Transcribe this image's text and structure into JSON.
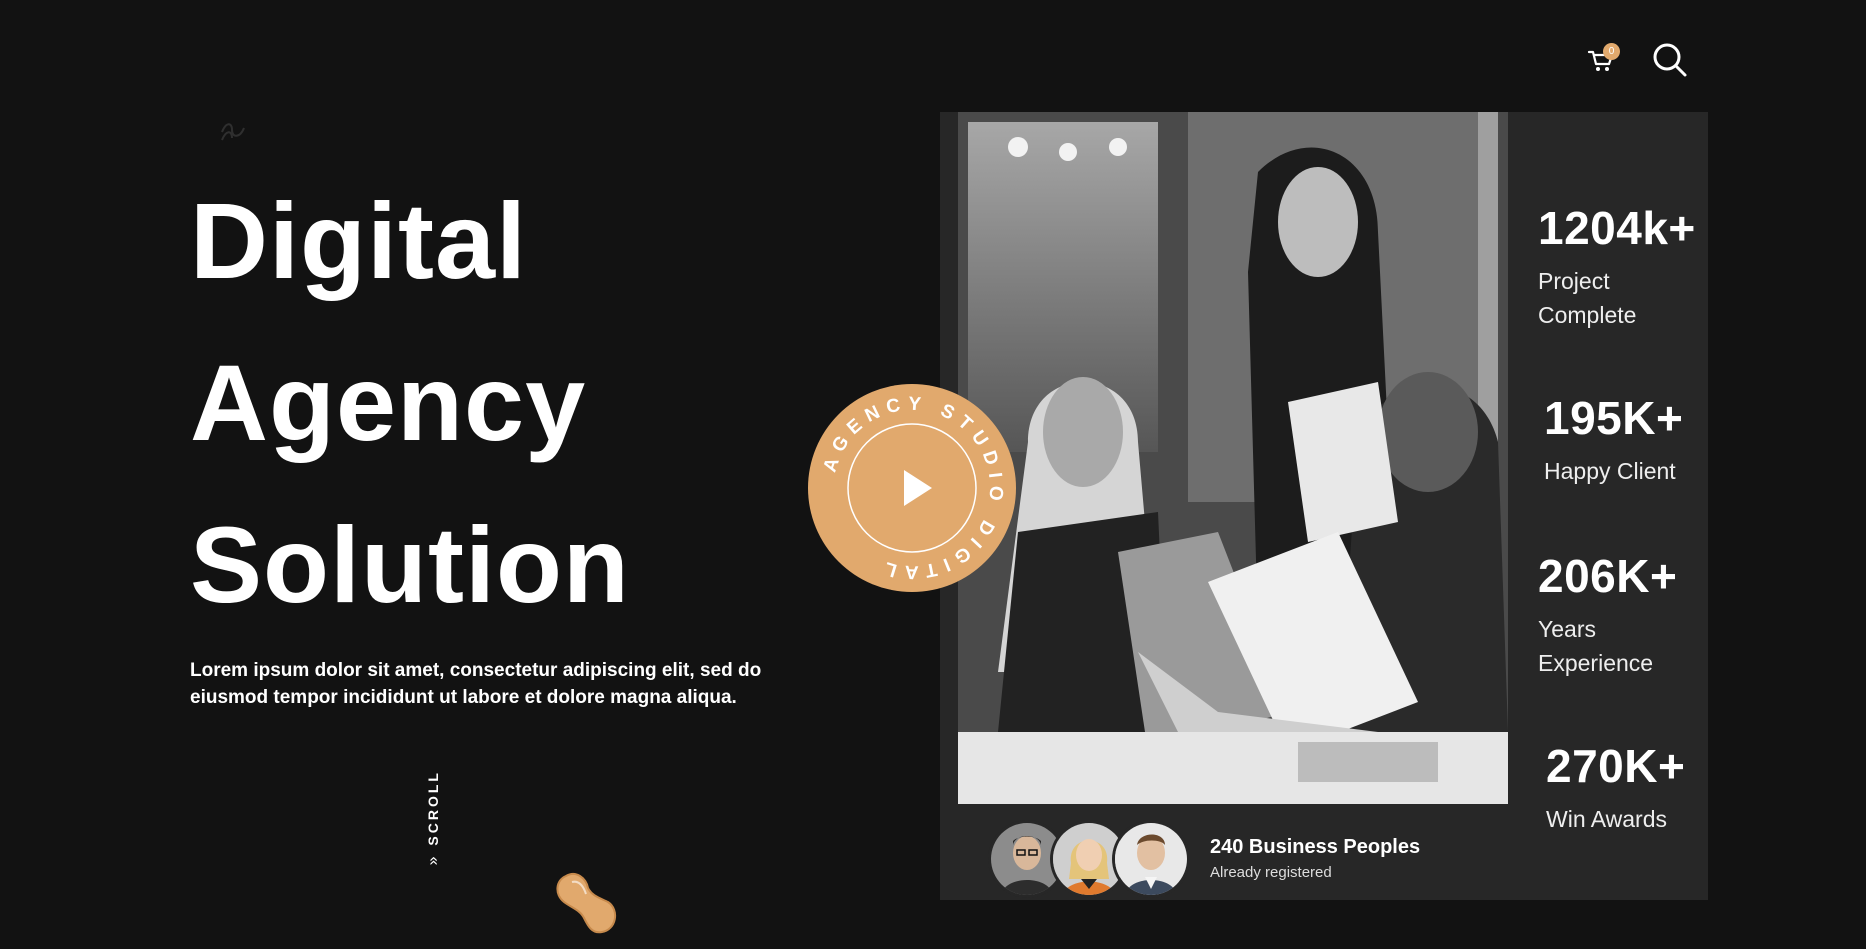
{
  "header": {
    "cart_count": "0",
    "icons": [
      "cart-icon",
      "search-icon"
    ]
  },
  "hero": {
    "title_lines": [
      "Digital",
      "Agency",
      "Solution"
    ],
    "description_line1": "Lorem ipsum dolor sit amet, consectetur adipiscing elit, sed do",
    "description_line2": "eiusmod tempor incididunt ut labore et dolore magna aliqua."
  },
  "scroll_label": "SCROLL",
  "badge": {
    "circular_text": "AGENCY STUDIO DIGITAL",
    "icon": "play-icon"
  },
  "stats": [
    {
      "value": "1204k+",
      "label_line1": "Project",
      "label_line2": "Complete"
    },
    {
      "value": "195K+",
      "label_line1": "Happy Client",
      "label_line2": ""
    },
    {
      "value": "206K+",
      "label_line1": "Years",
      "label_line2": "Experience"
    },
    {
      "value": "270K+",
      "label_line1": "Win Awards",
      "label_line2": ""
    }
  ],
  "people": {
    "title": "240 Business Peoples",
    "subtitle": "Already registered"
  },
  "colors": {
    "background": "#121212",
    "panel": "#272727",
    "accent": "#e1a96d",
    "text": "#ffffff"
  }
}
